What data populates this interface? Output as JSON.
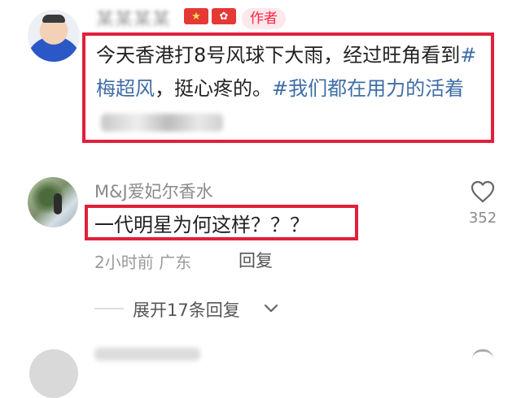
{
  "author_comment": {
    "flags": [
      "★",
      "✿"
    ],
    "author_badge": "作者",
    "text_plain": "今天香港打8号风球下大雨，经过旺角看到",
    "hashtag_1": "#梅超风",
    "text_mid": "，挺心疼的。",
    "hashtag_2": "#我们都在用力的活着"
  },
  "reply": {
    "username": "M&J爱妃尔香水",
    "text": "一代明星为何这样？？？",
    "time_location": "2小时前 广东",
    "reply_button": "回复",
    "like_count": "352"
  },
  "expand": {
    "label": "展开17条回复"
  },
  "colors": {
    "highlight_border": "#e0203c",
    "hashtag": "#3f6da6",
    "author_badge_text": "#ff2442",
    "author_badge_bg": "#fde8ec"
  },
  "icons": [
    "heart-icon",
    "chevron-down-icon",
    "flag-icon"
  ]
}
